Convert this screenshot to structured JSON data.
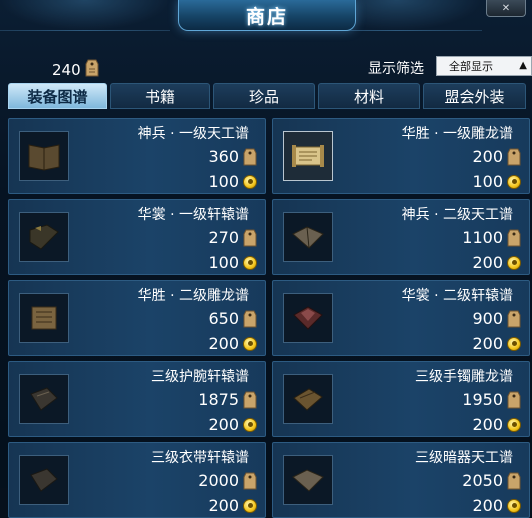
{
  "window": {
    "title": "商店",
    "close_icon": "close-icon"
  },
  "currency": {
    "amount": "240",
    "icon": "token-tag-icon"
  },
  "filter": {
    "label": "显示筛选",
    "selected": "全部显示",
    "icon": "dropdown-arrow-icon"
  },
  "tabs": [
    {
      "label": "装备图谱",
      "active": true
    },
    {
      "label": "书籍",
      "active": false
    },
    {
      "label": "珍品",
      "active": false
    },
    {
      "label": "材料",
      "active": false
    },
    {
      "label": "盟会外装",
      "active": false
    }
  ],
  "items": [
    {
      "name": "神兵 · 一级天工谱",
      "price": "360",
      "points": "100"
    },
    {
      "name": "华胜 · 一级雕龙谱",
      "price": "200",
      "points": "100"
    },
    {
      "name": "华裳 · 一级轩辕谱",
      "price": "270",
      "points": "100"
    },
    {
      "name": "神兵 · 二级天工谱",
      "price": "1100",
      "points": "200"
    },
    {
      "name": "华胜 · 二级雕龙谱",
      "price": "650",
      "points": "200"
    },
    {
      "name": "华裳 · 二级轩辕谱",
      "price": "900",
      "points": "200"
    },
    {
      "name": "三级护腕轩辕谱",
      "price": "1875",
      "points": "200"
    },
    {
      "name": "三级手镯雕龙谱",
      "price": "1950",
      "points": "200"
    },
    {
      "name": "三级衣带轩辕谱",
      "price": "2000",
      "points": "200"
    },
    {
      "name": "三级暗器天工谱",
      "price": "2050",
      "points": "200"
    }
  ],
  "colors": {
    "accent": "#5fa6d6",
    "card_bg": "#1b4368",
    "coin": "#f4c51a",
    "tag": "#c9a46a"
  }
}
